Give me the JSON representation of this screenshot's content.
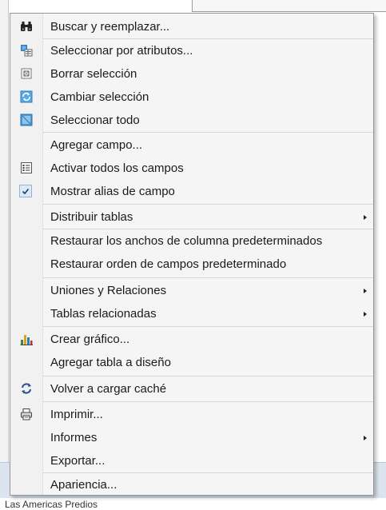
{
  "footer_text": "Las Americas Predios",
  "menu": {
    "find_replace": "Buscar y reemplazar...",
    "select_by_attributes": "Seleccionar por atributos...",
    "clear_selection": "Borrar selección",
    "switch_selection": "Cambiar selección",
    "select_all": "Seleccionar todo",
    "add_field": "Agregar campo...",
    "turn_all_fields_on": "Activar todos los campos",
    "show_field_aliases": "Mostrar alias de campo",
    "arrange_tables": "Distribuir tablas",
    "restore_column_widths": "Restaurar los anchos de columna predeterminados",
    "restore_field_order": "Restaurar orden de campos predeterminado",
    "joins_relates": "Uniones y Relaciones",
    "related_tables": "Tablas relacionadas",
    "create_graph": "Crear gráfico...",
    "add_table_to_layout": "Agregar tabla a diseño",
    "reload_cache": "Volver a cargar caché",
    "print": "Imprimir...",
    "reports": "Informes",
    "export": "Exportar...",
    "appearance": "Apariencia..."
  },
  "icons": {
    "find_replace": "binoculars-icon",
    "select_by_attributes": "select-by-attributes-icon",
    "clear_selection": "clear-selection-icon",
    "switch_selection": "switch-selection-icon",
    "select_all": "select-all-icon",
    "turn_all_fields_on": "field-list-icon",
    "show_field_aliases": "checkmark-icon",
    "create_graph": "bar-chart-icon",
    "reload_cache": "refresh-icon",
    "print": "printer-icon"
  },
  "colors": {
    "menu_background": "#f5f5f5",
    "separator": "#d6d6d6",
    "text": "#1a1a1a",
    "icon_blue": "#2d7fc1"
  }
}
